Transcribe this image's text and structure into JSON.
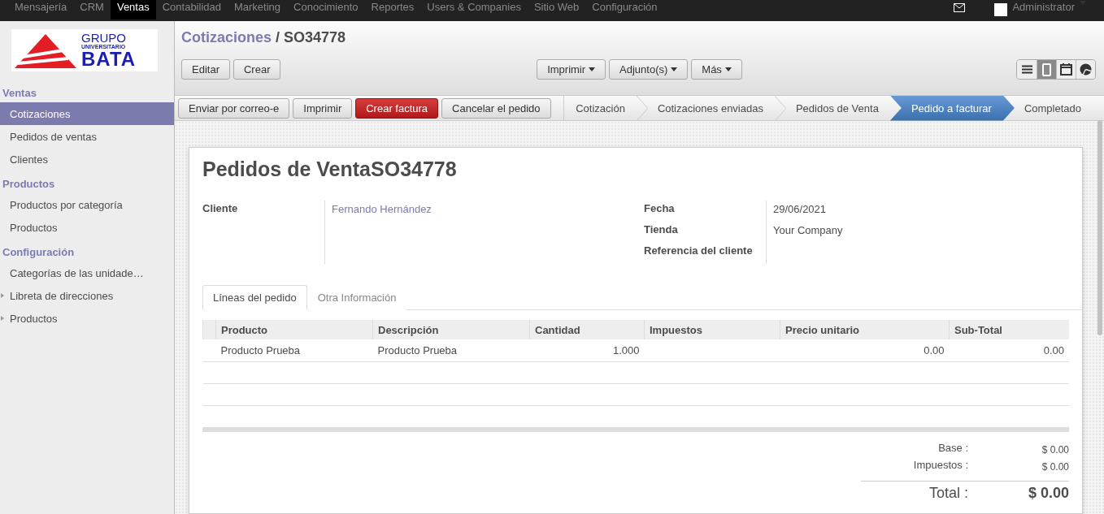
{
  "top_menu": [
    {
      "label": "Mensajería",
      "selected": false
    },
    {
      "label": "CRM",
      "selected": false
    },
    {
      "label": "Ventas",
      "selected": true
    },
    {
      "label": "Contabilidad",
      "selected": false
    },
    {
      "label": "Marketing",
      "selected": false
    },
    {
      "label": "Conocimiento",
      "selected": false
    },
    {
      "label": "Reportes",
      "selected": false
    },
    {
      "label": "Users & Companies",
      "selected": false
    },
    {
      "label": "Sitio Web",
      "selected": false
    },
    {
      "label": "Configuración",
      "selected": false
    }
  ],
  "user": {
    "name": "Administrator"
  },
  "logo": {
    "line_1": "GRUPO",
    "line_2": "UNIVERSITARIO",
    "line_3": "BATA"
  },
  "sidebar": [
    {
      "title": "Ventas",
      "items": [
        {
          "label": "Cotizaciones",
          "kind": "link",
          "selected": true
        },
        {
          "label": "Pedidos de ventas",
          "kind": "link",
          "selected": false
        },
        {
          "label": "Clientes",
          "kind": "link",
          "selected": false
        }
      ]
    },
    {
      "title": "Productos",
      "items": [
        {
          "label": "Productos por categoría",
          "kind": "link",
          "selected": false
        },
        {
          "label": "Productos",
          "kind": "link",
          "selected": false
        }
      ]
    },
    {
      "title": "Configuración",
      "items": [
        {
          "label": "Categorías de las unidade…",
          "kind": "link",
          "selected": false
        },
        {
          "label": "Libreta de direcciones",
          "kind": "folder",
          "selected": false
        },
        {
          "label": "Productos",
          "kind": "folder",
          "selected": false
        }
      ]
    }
  ],
  "breadcrumb": {
    "parent": "Cotizaciones",
    "separator": "/",
    "current": "SO34778"
  },
  "action_buttons": [
    "Editar",
    "Crear"
  ],
  "dropdowns": [
    "Imprimir",
    "Adjunto(s)",
    "Más"
  ],
  "views": [
    {
      "kind": "list",
      "selected": false
    },
    {
      "kind": "form",
      "selected": true
    },
    {
      "kind": "calendar",
      "selected": false
    },
    {
      "kind": "graph",
      "selected": false
    }
  ],
  "workflow_buttons": [
    {
      "label": "Enviar por correo-e",
      "kind": "normal"
    },
    {
      "label": "Imprimir",
      "kind": "normal"
    },
    {
      "label": "Crear factura",
      "kind": "primary"
    },
    {
      "label": "Cancelar el pedido",
      "kind": "normal"
    }
  ],
  "stages": [
    {
      "label": "Cotización",
      "selected": false
    },
    {
      "label": "Cotizaciones enviadas",
      "selected": false
    },
    {
      "label": "Pedidos de Venta",
      "selected": false
    },
    {
      "label": "Pedido a facturar",
      "selected": true
    },
    {
      "label": "Completado",
      "selected": false
    }
  ],
  "form": {
    "title": "Pedidos de Venta",
    "number": "SO34778",
    "left_fields": [
      {
        "label": "Cliente",
        "value": "Fernando Hernández",
        "kind": "link"
      }
    ],
    "right_fields": [
      {
        "label": "Fecha",
        "value": "29/06/2021"
      },
      {
        "label": "Tienda",
        "value": "Your Company"
      },
      {
        "label": "Referencia del cliente"
      }
    ],
    "tabs": [
      {
        "label": "Líneas del pedido",
        "selected": true
      },
      {
        "label": "Otra Información",
        "selected": false
      }
    ],
    "table": {
      "columns": [
        "Producto",
        "Descripción",
        "Cantidad",
        "Impuestos",
        "Precio unitario",
        "Sub-Total"
      ],
      "rows": [
        [
          "Producto Prueba",
          "Producto Prueba",
          "1.000",
          "",
          "0.00",
          "0.00"
        ]
      ]
    },
    "totals": [
      {
        "label": "Base :",
        "value": "$ 0.00"
      },
      {
        "label": "Impuestos :",
        "value": "$ 0.00"
      }
    ],
    "grand_total": {
      "label": "Total :",
      "value": "$ 0.00"
    }
  }
}
